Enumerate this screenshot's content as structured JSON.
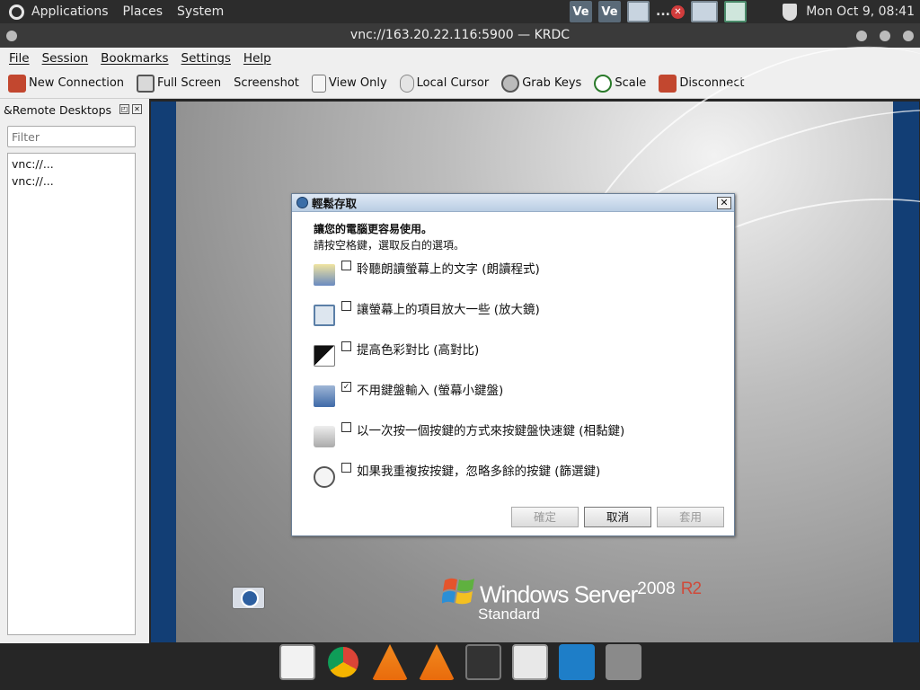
{
  "topbar": {
    "menus": [
      "Applications",
      "Places",
      "System"
    ],
    "clock": "Mon Oct  9, 08:41",
    "tray_icons": [
      "ve-icon",
      "ve-icon",
      "window-icon",
      "dots",
      "close-icon",
      "window-icon"
    ],
    "ve_label": "Ve",
    "dots_label": "...",
    "close_glyph": "✕"
  },
  "window": {
    "title": "vnc://163.20.22.116:5900 — KRDC"
  },
  "menubar": [
    "File",
    "Session",
    "Bookmarks",
    "Settings",
    "Help"
  ],
  "toolbar": [
    {
      "label": "New Connection",
      "icon": "new-connection-icon"
    },
    {
      "label": "Full Screen",
      "icon": "fullscreen-icon"
    },
    {
      "label": "Screenshot",
      "icon": ""
    },
    {
      "label": "View Only",
      "icon": "view-only-icon"
    },
    {
      "label": "Local Cursor",
      "icon": "cursor-icon"
    },
    {
      "label": "Grab Keys",
      "icon": "grab-keys-icon"
    },
    {
      "label": "Scale",
      "icon": "scale-icon"
    },
    {
      "label": "Disconnect",
      "icon": "disconnect-icon"
    }
  ],
  "sidepanel": {
    "title": "&Remote Desktops",
    "float_glyph": "◰",
    "close_glyph": "✕",
    "filter_placeholder": "Filter",
    "items": [
      "vnc://...",
      "vnc://..."
    ]
  },
  "dialog": {
    "title": "輕鬆存取",
    "close_glyph": "✕",
    "heading": "讓您的電腦更容易使用。",
    "subheading": "請按空格鍵，選取反白的選項。",
    "check_glyph": "✓",
    "options": [
      {
        "label": "聆聽朗讀螢幕上的文字 (朗讀程式)",
        "checked": false,
        "icon": "narrator-icon"
      },
      {
        "label": "讓螢幕上的項目放大一些 (放大鏡)",
        "checked": false,
        "icon": "magnifier-icon"
      },
      {
        "label": "提高色彩對比 (高對比)",
        "checked": false,
        "icon": "high-contrast-icon"
      },
      {
        "label": "不用鍵盤輸入 (螢幕小鍵盤)",
        "checked": true,
        "icon": "on-screen-keyboard-icon"
      },
      {
        "label": "以一次按一個按鍵的方式來按鍵盤快速鍵 (相黏鍵)",
        "checked": false,
        "icon": "sticky-keys-icon"
      },
      {
        "label": "如果我重複按按鍵，忽略多餘的按鍵 (篩選鍵)",
        "checked": false,
        "icon": "filter-keys-icon"
      }
    ],
    "buttons": {
      "ok": "確定",
      "cancel": "取消",
      "apply": "套用"
    }
  },
  "remote_desktop": {
    "brand_line": "Windows Server",
    "version": "2008",
    "release": "R2",
    "edition": "Standard"
  },
  "dock": [
    "text-editor-icon",
    "chrome-icon",
    "vlc-icon",
    "vlc-icon",
    "terminal-icon",
    "image-viewer-icon",
    "ve-icon",
    "help-icon"
  ]
}
